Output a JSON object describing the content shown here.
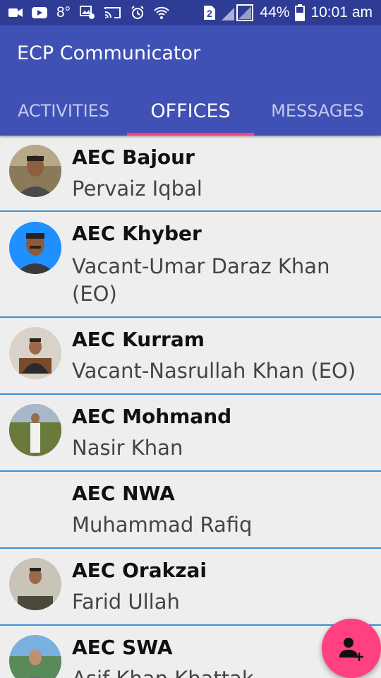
{
  "status_bar": {
    "temperature": "8°",
    "sim_label": "2",
    "battery": "44%",
    "time": "10:01 am",
    "icons": [
      "video-icon",
      "youtube-icon",
      "gallery-icon",
      "cast-icon",
      "alarm-icon",
      "wifi-icon",
      "sim-icon",
      "signal-icon",
      "battery-icon"
    ]
  },
  "app_bar": {
    "title": "ECP Communicator"
  },
  "tabs": [
    {
      "label": "ACTIVITIES",
      "active": false
    },
    {
      "label": "OFFICES",
      "active": true
    },
    {
      "label": "MESSAGES",
      "active": false
    }
  ],
  "offices": [
    {
      "name": "AEC Bajour",
      "officer": "Pervaiz Iqbal",
      "avatar": "photo"
    },
    {
      "name": "AEC Khyber",
      "officer": "Vacant-Umar Daraz Khan (EO)",
      "avatar": "photo"
    },
    {
      "name": "AEC Kurram",
      "officer": "Vacant-Nasrullah Khan (EO)",
      "avatar": "photo"
    },
    {
      "name": "AEC Mohmand",
      "officer": "Nasir Khan",
      "avatar": "photo"
    },
    {
      "name": "AEC NWA",
      "officer": "Muhammad Rafiq",
      "avatar": "none"
    },
    {
      "name": "AEC Orakzai",
      "officer": "Farid Ullah",
      "avatar": "photo"
    },
    {
      "name": "AEC SWA",
      "officer": "Asif Khan Khattak",
      "avatar": "photo"
    }
  ],
  "fab": {
    "icon": "add-person-icon"
  },
  "colors": {
    "primary": "#3f51b5",
    "primary_dark": "#2e3c96",
    "accent": "#ff4081",
    "divider": "#3f8fd6",
    "background": "#eeeeee"
  }
}
